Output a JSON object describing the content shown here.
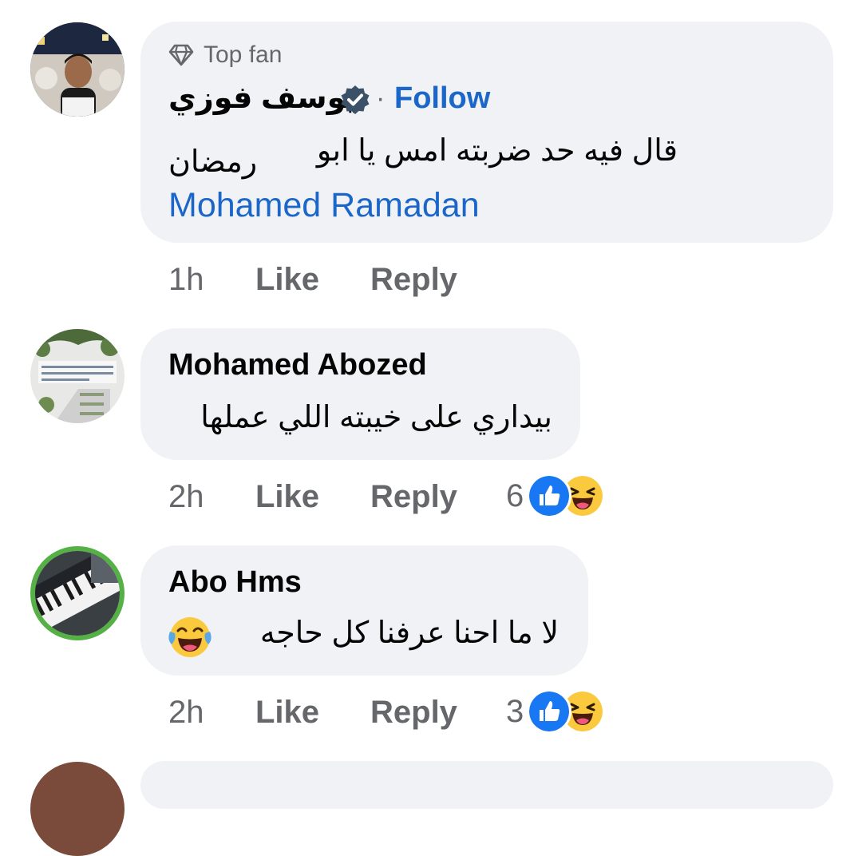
{
  "comments": [
    {
      "badge": "Top fan",
      "author": "يوسف فوزي",
      "separator": "·",
      "follow_label": "Follow",
      "line1": "قال فيه حد ضربته امس يا ابو",
      "line2": "رمضان",
      "mention": "Mohamed Ramadan",
      "time": "1h",
      "like_label": "Like",
      "reply_label": "Reply"
    },
    {
      "author": "Mohamed Abozed",
      "text": "بيداري على خيبته اللي عملها",
      "time": "2h",
      "like_label": "Like",
      "reply_label": "Reply",
      "reaction_count": "6"
    },
    {
      "author": "Abo Hms",
      "text": "لا ما احنا عرفنا كل حاجه",
      "time": "2h",
      "like_label": "Like",
      "reply_label": "Reply",
      "reaction_count": "3"
    }
  ],
  "icons": {
    "top_fan": "diamond-icon",
    "verified": "verified-badge-icon",
    "reaction_like": "like-reaction-icon",
    "reaction_haha": "haha-reaction-icon",
    "emoji_tears": "tears-of-joy-emoji-icon"
  },
  "colors": {
    "link_blue": "#1b66c9",
    "bubble_bg": "#f0f2f5",
    "secondary_text": "#65676b"
  }
}
